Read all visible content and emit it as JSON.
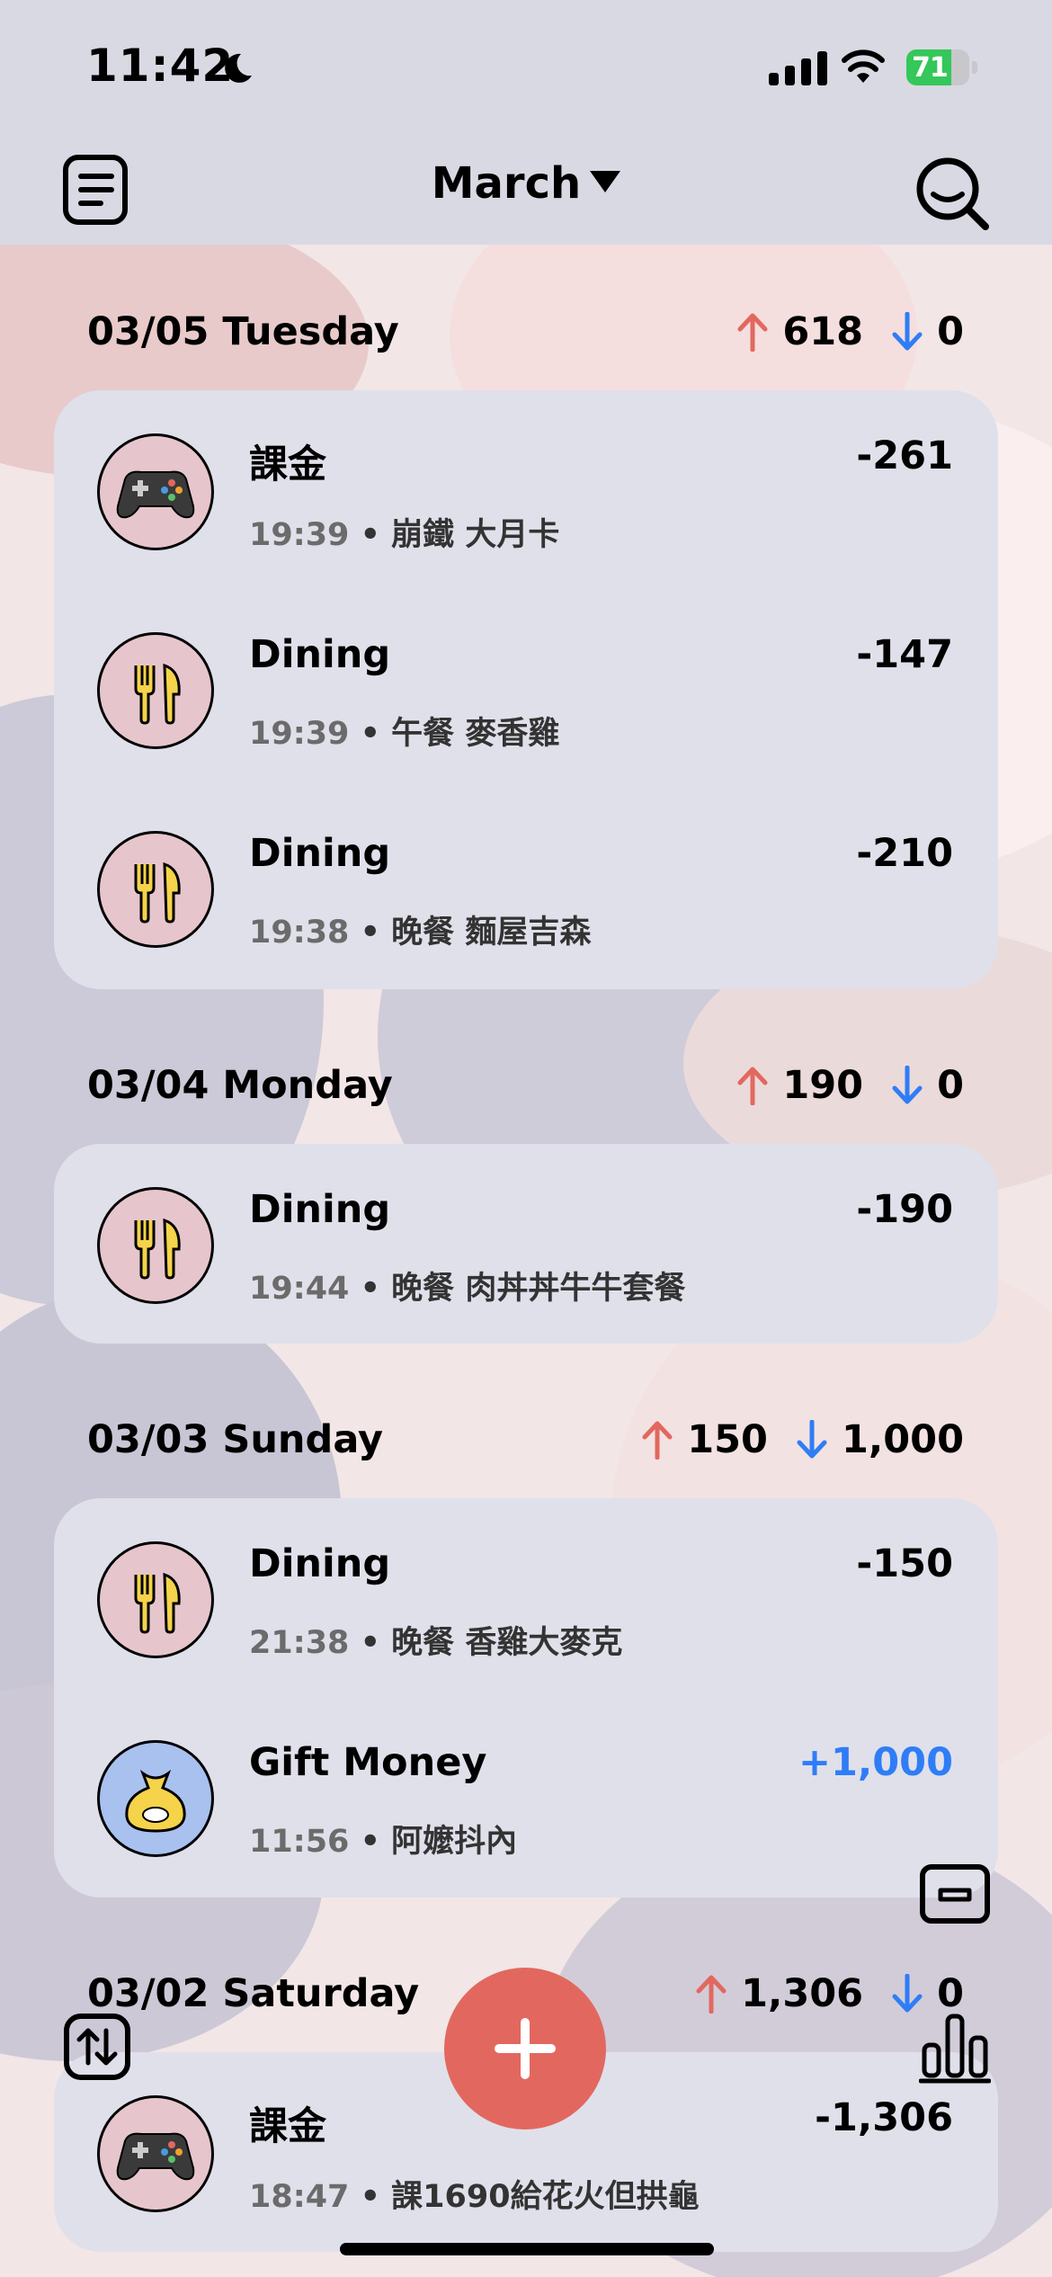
{
  "status_bar": {
    "time": "11:42",
    "battery": "71",
    "battery_level": 0.71
  },
  "header": {
    "month": "March"
  },
  "days": [
    {
      "title": "03/05 Tuesday",
      "expense_total": "618",
      "income_total": "0",
      "items": [
        {
          "category": "課金",
          "icon": "game-controller-icon",
          "amount": "-261",
          "time": "19:39",
          "note": "崩鐵 大月卡"
        },
        {
          "category": "Dining",
          "icon": "fork-knife-icon",
          "amount": "-147",
          "time": "19:39",
          "note": "午餐 麥香雞"
        },
        {
          "category": "Dining",
          "icon": "fork-knife-icon",
          "amount": "-210",
          "time": "19:38",
          "note": "晚餐 麵屋吉森"
        }
      ]
    },
    {
      "title": "03/04 Monday",
      "expense_total": "190",
      "income_total": "0",
      "items": [
        {
          "category": "Dining",
          "icon": "fork-knife-icon",
          "amount": "-190",
          "time": "19:44",
          "note": "晚餐 肉丼丼牛牛套餐"
        }
      ]
    },
    {
      "title": "03/03 Sunday",
      "expense_total": "150",
      "income_total": "1,000",
      "items": [
        {
          "category": "Dining",
          "icon": "fork-knife-icon",
          "amount": "-150",
          "time": "21:38",
          "note": "晚餐 香雞大麥克"
        },
        {
          "category": "Gift Money",
          "icon": "money-bag-icon",
          "amount": "+1,000",
          "time": "11:56",
          "note": "阿嬤抖內"
        }
      ]
    },
    {
      "title": "03/02 Saturday",
      "expense_total": "1,306",
      "income_total": "0",
      "items": [
        {
          "category": "課金",
          "icon": "game-controller-icon",
          "amount": "-1,306",
          "time": "18:47",
          "note": "課1690給花火但拱龜"
        }
      ]
    }
  ],
  "sep": "•",
  "colors": {
    "expense": "#e2685f",
    "income": "#2f7df6",
    "accent": "#e2685f"
  }
}
